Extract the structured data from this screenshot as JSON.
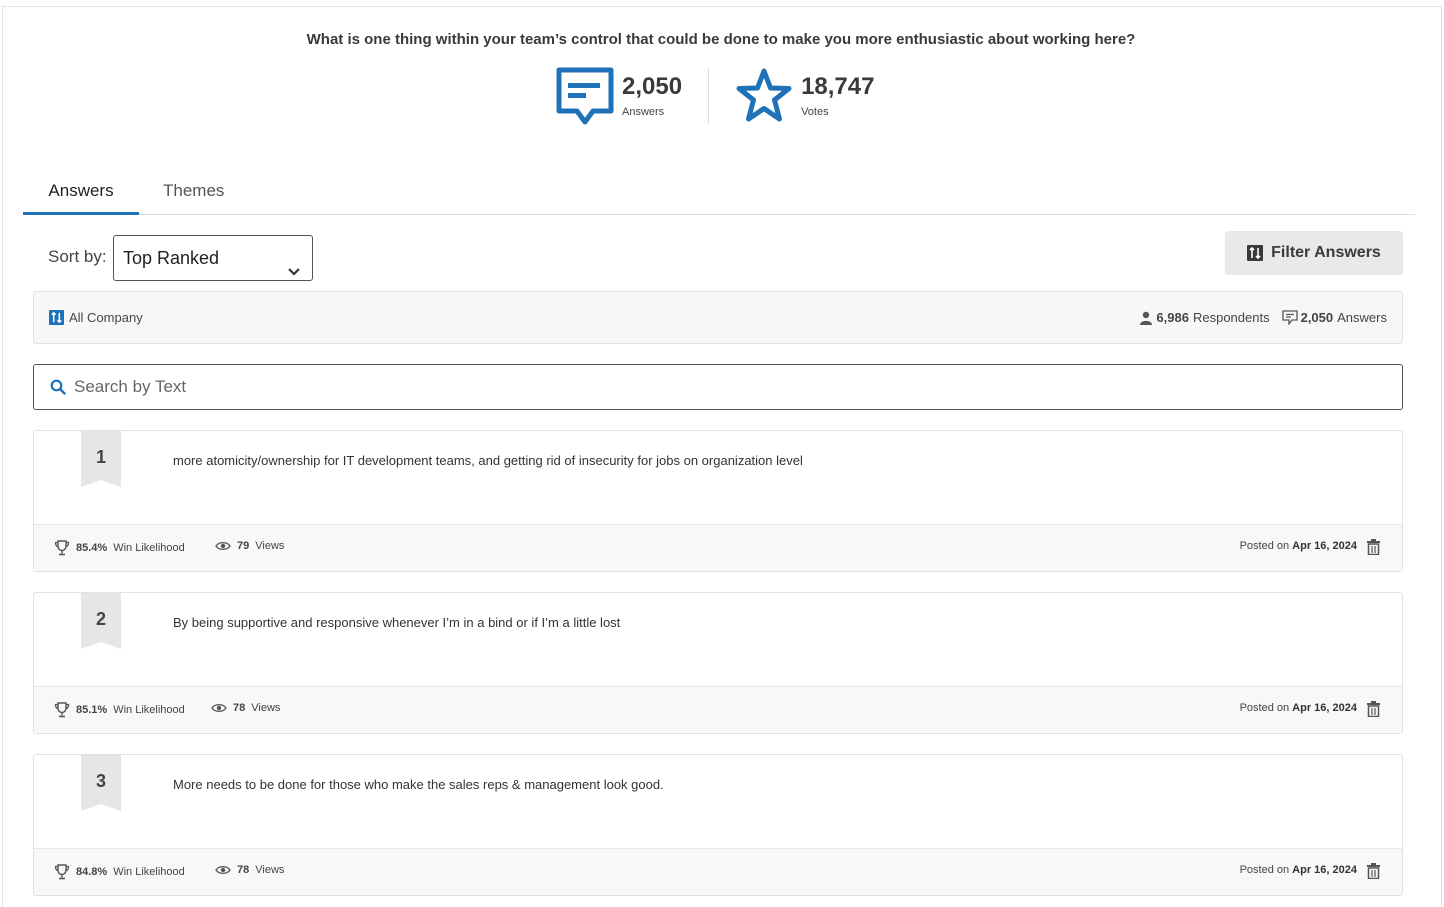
{
  "question": "What is one thing within your team’s control that could be done to make you more enthusiastic about working here?",
  "stats": {
    "answers": {
      "value": "2,050",
      "label": "Answers",
      "icon": "comment-icon"
    },
    "votes": {
      "value": "18,747",
      "label": "Votes",
      "icon": "star-icon"
    }
  },
  "tabs": [
    {
      "label": "Answers",
      "active": true
    },
    {
      "label": "Themes",
      "active": false
    }
  ],
  "sort": {
    "label": "Sort by:",
    "selected": "Top Ranked"
  },
  "filter_button": {
    "label": "Filter Answers",
    "icon": "filter-icon"
  },
  "filter_bar": {
    "scope": "All Company",
    "respondents_count": "6,986",
    "respondents_label": "Respondents",
    "answers_count": "2,050",
    "answers_label": "Answers"
  },
  "search": {
    "placeholder": "Search by Text"
  },
  "answers": [
    {
      "rank": "1",
      "text": "more atomicity/ownership for IT development teams, and getting rid of insecurity for jobs on organization level",
      "win_likelihood": "85.4%",
      "win_label": "Win Likelihood",
      "views": "79",
      "views_label": "Views",
      "posted_prefix": "Posted on",
      "posted_date": "Apr 16, 2024"
    },
    {
      "rank": "2",
      "text": "By being supportive and responsive whenever I’m in a bind or if I’m a little lost",
      "win_likelihood": "85.1%",
      "win_label": "Win Likelihood",
      "views": "78",
      "views_label": "Views",
      "posted_prefix": "Posted on",
      "posted_date": "Apr 16, 2024"
    },
    {
      "rank": "3",
      "text": "More needs to be done for those who make the sales reps & management look good.",
      "win_likelihood": "84.8%",
      "win_label": "Win Likelihood",
      "views": "78",
      "views_label": "Views",
      "posted_prefix": "Posted on",
      "posted_date": "Apr 16, 2024"
    }
  ],
  "colors": {
    "accent": "#1f72b8",
    "text": "#333333",
    "muted_bg": "#f7f7f7",
    "rank_ribbon": "#e6e6e6"
  }
}
